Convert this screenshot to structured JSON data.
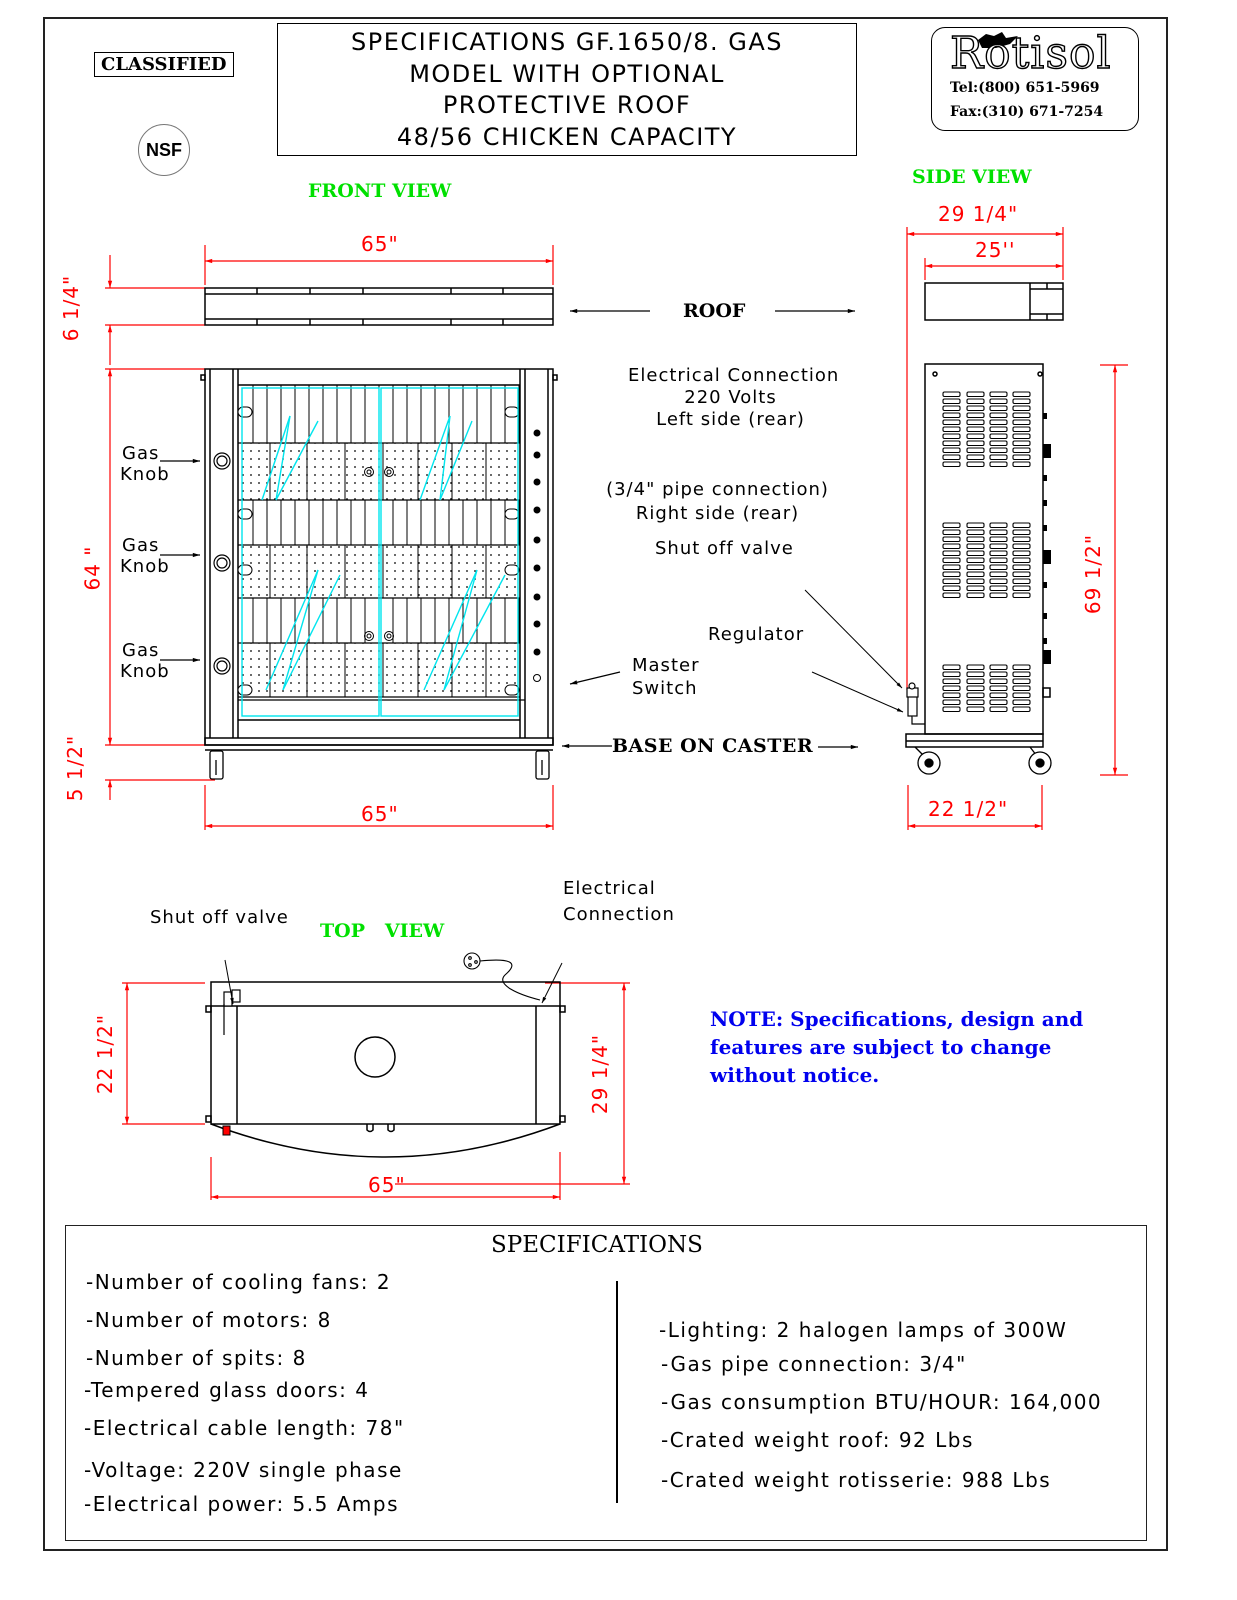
{
  "header": {
    "classified_label": "CLASSIFIED",
    "nsf_badge": "NSF",
    "title_lines": [
      "SPECIFICATIONS GF.1650/8. GAS",
      "MODEL WITH OPTIONAL",
      "PROTECTIVE ROOF",
      "48/56 CHICKEN CAPACITY"
    ],
    "logo": {
      "brand": "Rotisol",
      "tel": "Tel:(800) 651-5969",
      "fax": "Fax:(310) 671-7254"
    }
  },
  "front_view": {
    "label": "FRONT VIEW",
    "dim_roof_width": "65\"",
    "dim_roof_height": "6 1/4\"",
    "dim_body_height": "64 \"",
    "dim_base_height": "5 1/2\"",
    "dim_base_width": "65\"",
    "gas_knob_labels": [
      {
        "line1": "Gas",
        "line2": "Knob"
      },
      {
        "line1": "Gas",
        "line2": "Knob"
      },
      {
        "line1": "Gas",
        "line2": "Knob"
      }
    ],
    "roof_label": "ROOF",
    "base_label": "BASE ON CASTER",
    "master_switch": {
      "line1": "Master",
      "line2": "Switch"
    }
  },
  "annotations": {
    "electrical": [
      "Electrical Connection",
      "220 Volts",
      "Left side (rear)"
    ],
    "pipe": [
      "(3/4\" pipe connection)",
      "Right side (rear)"
    ],
    "shut_off_valve": "Shut off valve",
    "regulator": "Regulator"
  },
  "side_view": {
    "label": "SIDE VIEW",
    "dim_overall_depth": "29 1/4\"",
    "dim_roof_depth": "25''",
    "dim_height": "69 1/2\"",
    "dim_base_depth": "22 1/2\""
  },
  "top_view": {
    "label": "TOP   VIEW",
    "shut_off_valve": "Shut off valve",
    "electrical": [
      "Electrical",
      "Connection"
    ],
    "dim_depth_left": "22 1/2\"",
    "dim_depth_right": "29 1/4\"",
    "dim_width": "65\""
  },
  "note": "NOTE: Specifications, design and features are subject to change without notice.",
  "specifications": {
    "title": "SPECIFICATIONS",
    "left": [
      "-Number of cooling fans: 2",
      "-Number of motors: 8",
      "-Number of spits: 8",
      "-Tempered glass doors: 4",
      "-Electrical cable length: 78\"",
      "-Voltage: 220V single phase",
      "-Electrical power: 5.5 Amps"
    ],
    "right": [
      "-Lighting: 2 halogen lamps of 300W",
      "-Gas pipe connection: 3/4\"",
      "-Gas consumption BTU/HOUR: 164,000",
      "-Crated weight roof: 92 Lbs",
      "-Crated weight rotisserie: 988 Lbs"
    ]
  },
  "colors": {
    "dimension": "#ff0000",
    "view_label": "#00e000",
    "glass": "#00e5ee",
    "note": "#0000ee"
  }
}
